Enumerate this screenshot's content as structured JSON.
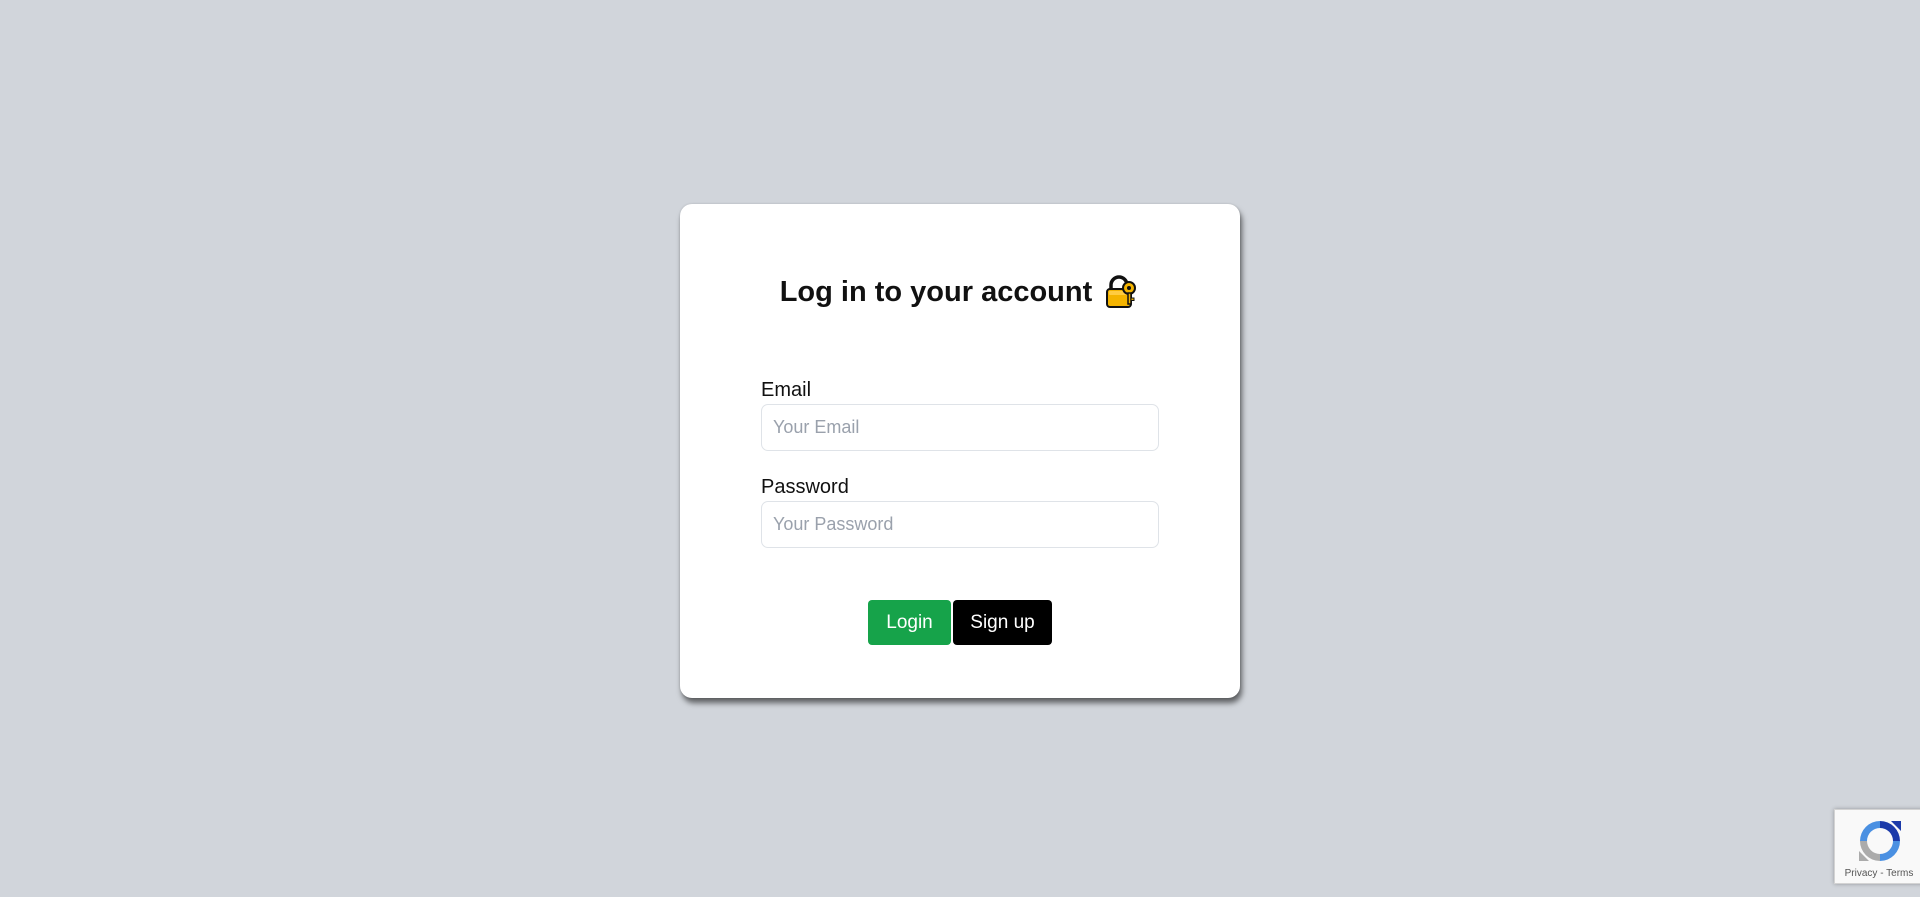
{
  "login_card": {
    "title": "Log in to your account",
    "title_icon": "lock-key-icon",
    "email": {
      "label": "Email",
      "value": "",
      "placeholder": "Your Email"
    },
    "password": {
      "label": "Password",
      "value": "",
      "placeholder": "Your Password"
    },
    "buttons": {
      "login_label": "Login",
      "signup_label": "Sign up"
    }
  },
  "recaptcha": {
    "privacy_label": "Privacy",
    "separator": " - ",
    "terms_label": "Terms"
  },
  "colors": {
    "background": "#d1d5db",
    "card": "#ffffff",
    "login_button": "#16a34a",
    "signup_button": "#000000",
    "lock_icon": "#f4b400"
  }
}
